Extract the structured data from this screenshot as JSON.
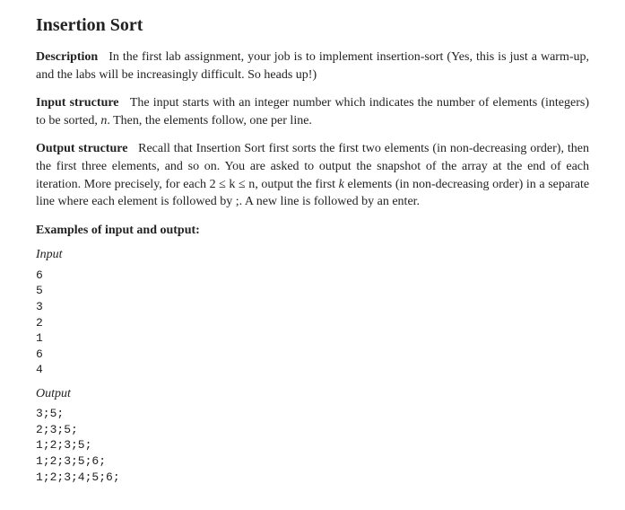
{
  "title": "Insertion Sort",
  "sections": {
    "description": {
      "label": "Description",
      "text": "In the first lab assignment, your job is to implement insertion-sort (Yes, this is just a warm-up, and the labs will be increasingly difficult. So heads up!)"
    },
    "input_structure": {
      "label": "Input structure",
      "text_before_n": "The input starts with an integer number which indicates the number of elements (integers) to be sorted,",
      "var_n": "n",
      "text_after_n": ". Then, the elements follow, one per line."
    },
    "output_structure": {
      "label": "Output structure",
      "text_before_ineq": "Recall that Insertion Sort first sorts the first two elements (in non-decreasing order), then the first three elements, and so on. You are asked to output the snapshot of the array at the end of each iteration. More precisely, for each",
      "inequality": "2 ≤ k ≤ n",
      "text_mid": ", output the first",
      "var_k": "k",
      "text_after_k": "elements (in non-decreasing order) in a separate line where each element is followed by ;. A new line is followed by an enter."
    },
    "examples": {
      "label": "Examples of input and output:",
      "input_label": "Input",
      "input": "6\n5\n3\n2\n1\n6\n4",
      "output_label": "Output",
      "output": "3;5;\n2;3;5;\n1;2;3;5;\n1;2;3;5;6;\n1;2;3;4;5;6;"
    }
  }
}
